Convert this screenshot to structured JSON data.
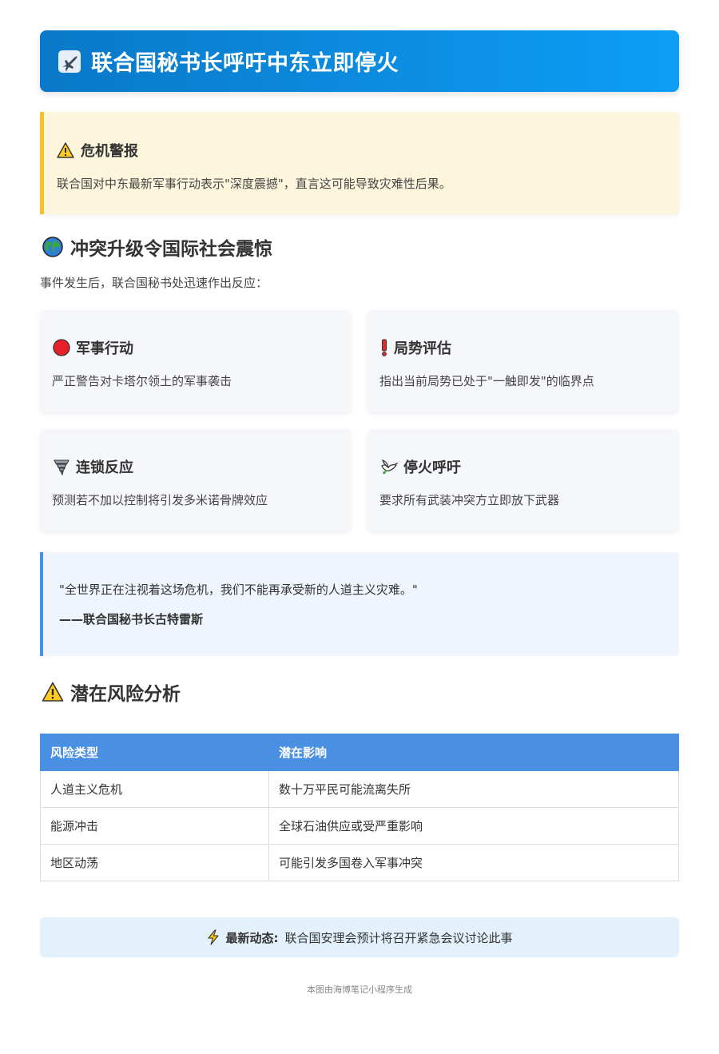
{
  "header": {
    "title": "联合国秘书长呼吁中东立即停火",
    "icon": "airplane-icon"
  },
  "alert": {
    "title": "危机警报",
    "icon": "warning-icon",
    "text": "联合国对中东最新军事行动表示\"深度震撼\"，直言这可能导致灾难性后果。",
    "accent_color": "#f6c229"
  },
  "section1": {
    "title": "冲突升级令国际社会震惊",
    "icon": "globe-icon",
    "intro": "事件发生后，联合国秘书处迅速作出反应："
  },
  "cards": [
    {
      "title": "军事行动",
      "icon": "red-circle-icon",
      "text": "严正警告对卡塔尔领土的军事袭击"
    },
    {
      "title": "局势评估",
      "icon": "exclamation-icon",
      "text": "指出当前局势已处于\"一触即发\"的临界点"
    },
    {
      "title": "连锁反应",
      "icon": "tornado-icon",
      "text": "预测若不加以控制将引发多米诺骨牌效应"
    },
    {
      "title": "停火呼吁",
      "icon": "dove-icon",
      "text": "要求所有武装冲突方立即放下武器"
    }
  ],
  "quote": {
    "text": "\"全世界正在注视着这场危机，我们不能再承受新的人道主义灾难。\"",
    "author": "——联合国秘书长古特雷斯"
  },
  "section2": {
    "title": "潜在风险分析",
    "icon": "warning-icon"
  },
  "table": {
    "headers": [
      "风险类型",
      "潜在影响"
    ],
    "rows": [
      [
        "人道主义危机",
        "数十万平民可能流离失所"
      ],
      [
        "能源冲击",
        "全球石油供应或受严重影响"
      ],
      [
        "地区动荡",
        "可能引发多国卷入军事冲突"
      ]
    ],
    "header_color": "#4a90e2"
  },
  "news": {
    "label": "最新动态:",
    "text": "联合国安理会预计将召开紧急会议讨论此事",
    "icon": "lightning-icon"
  },
  "footer": {
    "text": "本图由海博笔记小程序生成"
  }
}
